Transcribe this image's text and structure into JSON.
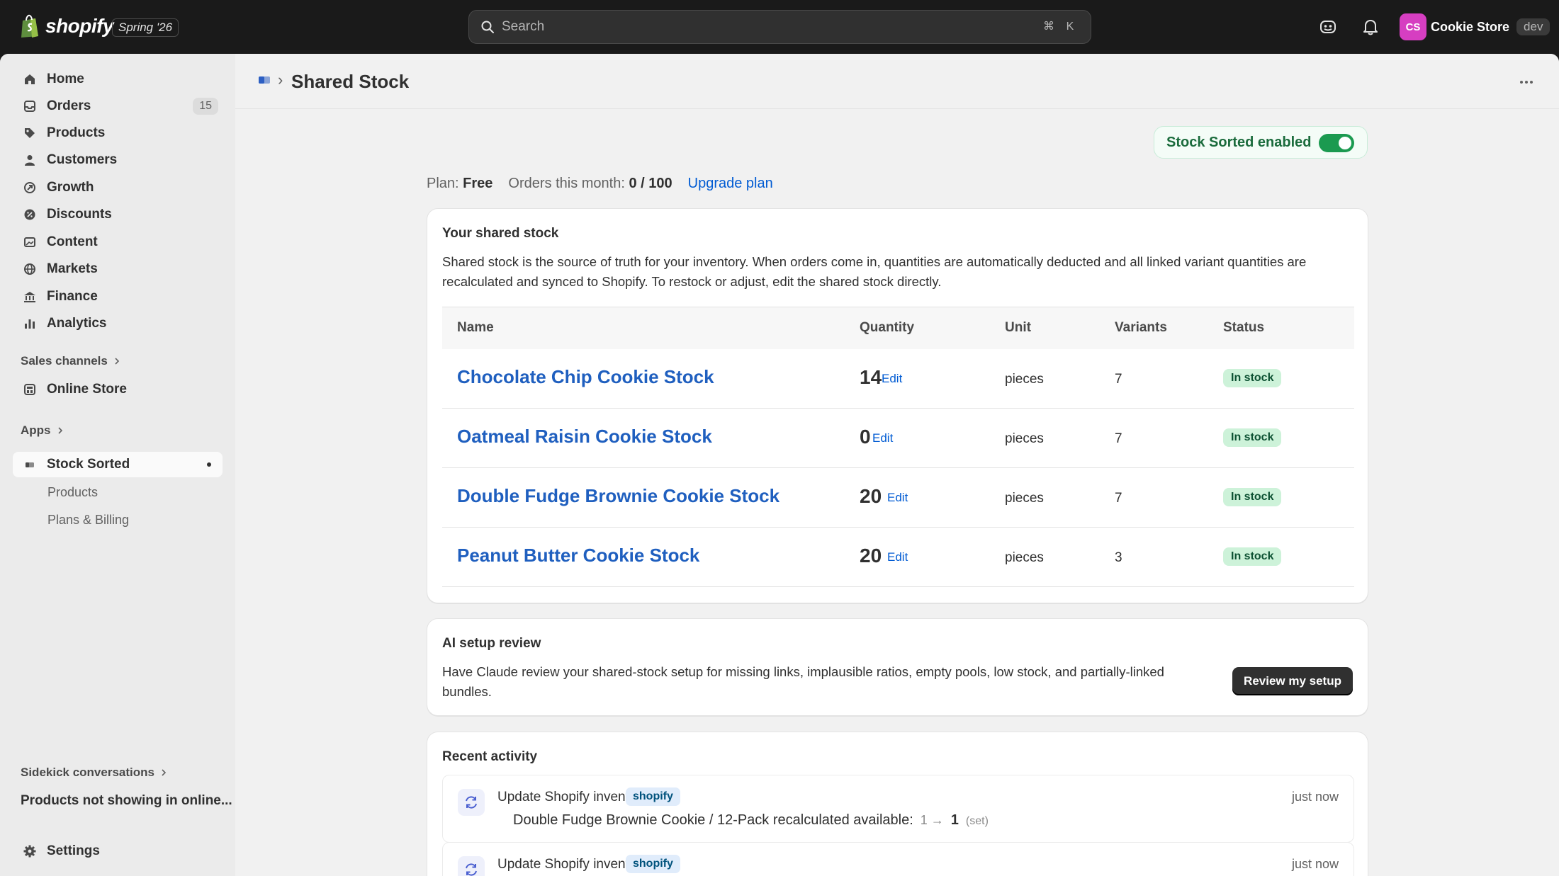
{
  "topbar": {
    "brand": "shopify",
    "edition": "Spring '26",
    "search_placeholder": "Search",
    "shortcut_mod": "⌘",
    "shortcut_key": "K",
    "avatar_initials": "CS",
    "store_name": "Cookie Store",
    "env_badge": "dev"
  },
  "sidebar": {
    "items": [
      {
        "label": "Home",
        "icon": "home-icon"
      },
      {
        "label": "Orders",
        "icon": "inbox-icon",
        "count": "15"
      },
      {
        "label": "Products",
        "icon": "tag-icon"
      },
      {
        "label": "Customers",
        "icon": "person-icon"
      },
      {
        "label": "Growth",
        "icon": "growth-icon"
      },
      {
        "label": "Discounts",
        "icon": "discount-icon"
      },
      {
        "label": "Content",
        "icon": "content-icon"
      },
      {
        "label": "Markets",
        "icon": "globe-icon"
      },
      {
        "label": "Finance",
        "icon": "bank-icon"
      },
      {
        "label": "Analytics",
        "icon": "bar-chart-icon"
      }
    ],
    "sales_channels": "Sales channels",
    "online_store": "Online Store",
    "apps": "Apps",
    "app_name": "Stock Sorted",
    "app_sub": [
      "Products",
      "Plans & Billing"
    ],
    "sidekick": "Sidekick conversations",
    "sidekick_item": "Products not showing in online...",
    "settings": "Settings"
  },
  "header": {
    "separator": "›",
    "title": "Shared Stock"
  },
  "toggle": {
    "label": "Stock Sorted enabled",
    "on": true
  },
  "plan": {
    "plan_label": "Plan:",
    "plan_value": "Free",
    "orders_label": "Orders this month:",
    "orders_value": "0 / 100",
    "upgrade": "Upgrade plan"
  },
  "shared_stock": {
    "title": "Your shared stock",
    "description": "Shared stock is the source of truth for your inventory. When orders come in, quantities are automatically deducted and all linked variant quantities are recalculated and synced to Shopify. To restock or adjust, edit the shared stock directly.",
    "columns": [
      "Name",
      "Quantity",
      "Unit",
      "Variants",
      "Status"
    ],
    "edit_label": "Edit",
    "rows": [
      {
        "name": "Chocolate Chip Cookie Stock",
        "quantity": "14",
        "unit": "pieces",
        "variants": "7",
        "status": "In stock"
      },
      {
        "name": "Oatmeal Raisin Cookie Stock",
        "quantity": "0",
        "unit": "pieces",
        "variants": "7",
        "status": "In stock"
      },
      {
        "name": "Double Fudge Brownie Cookie Stock",
        "quantity": "20",
        "unit": "pieces",
        "variants": "7",
        "status": "In stock"
      },
      {
        "name": "Peanut Butter Cookie Stock",
        "quantity": "20",
        "unit": "pieces",
        "variants": "3",
        "status": "In stock"
      }
    ]
  },
  "ai_review": {
    "title": "AI setup review",
    "description": "Have Claude review your shared-stock setup for missing links, implausible ratios, empty pools, low stock, and partially-linked bundles.",
    "button": "Review my setup"
  },
  "activity": {
    "title": "Recent activity",
    "items": [
      {
        "title": "Update Shopify inventory",
        "tag": "shopify",
        "time": "just now",
        "detail": "Double Fudge Brownie Cookie / 12-Pack recalculated available:",
        "from": "1 →",
        "to": "1",
        "note": "(set)"
      },
      {
        "title": "Update Shopify inventory",
        "tag": "shopify",
        "time": "just now"
      }
    ]
  },
  "colors": {
    "accent_link": "#005bd3",
    "success": "#1b9a50",
    "avatar": "#d63ec1"
  }
}
